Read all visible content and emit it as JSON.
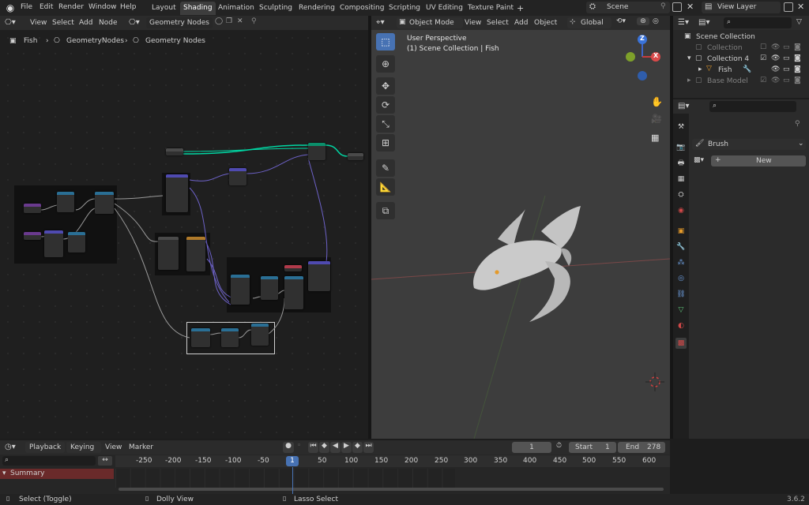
{
  "topbar": {
    "menus": [
      "File",
      "Edit",
      "Render",
      "Window",
      "Help"
    ],
    "workspaces": [
      "Layout",
      "Shading",
      "Animation",
      "Sculpting",
      "Rendering",
      "Compositing",
      "Scripting",
      "UV Editing",
      "Texture Paint"
    ],
    "active_workspace": "Shading",
    "add_workspace": "+",
    "scene": "Scene",
    "view_layer": "View Layer"
  },
  "node_editor": {
    "menus": [
      "View",
      "Select",
      "Add",
      "Node"
    ],
    "node_tree_name": "Geometry Nodes",
    "breadcrumb": [
      "Fish",
      "GeometryNodes",
      "Geometry Nodes"
    ]
  },
  "viewport": {
    "mode": "Object Mode",
    "menus": [
      "View",
      "Select",
      "Add",
      "Object"
    ],
    "orientation": "Global",
    "overlay_title": "User Perspective",
    "overlay_subtitle": "(1) Scene Collection | Fish",
    "gizmo_axes": [
      "Z",
      "X",
      "Y"
    ]
  },
  "outliner": {
    "root": "Scene Collection",
    "items": [
      {
        "label": "Collection",
        "dim": true
      },
      {
        "label": "Collection 4",
        "dim": false
      },
      {
        "label": "Fish",
        "dim": false
      },
      {
        "label": "Base Model",
        "dim": true
      }
    ]
  },
  "properties": {
    "brush_label": "Brush",
    "new_button": "New"
  },
  "timeline": {
    "menus": [
      "Playback",
      "Keying",
      "View",
      "Marker"
    ],
    "current_frame": "1",
    "start_label": "Start",
    "start_value": "1",
    "end_label": "End",
    "end_value": "278",
    "ruler": [
      "-250",
      "-200",
      "-150",
      "-100",
      "-50",
      "1",
      "50",
      "100",
      "150",
      "200",
      "250",
      "300",
      "350",
      "400",
      "450",
      "500",
      "550",
      "600"
    ],
    "summary": "Summary"
  },
  "statusbar": {
    "select": "Select (Toggle)",
    "dolly": "Dolly View",
    "lasso": "Lasso Select",
    "version": "3.6.2"
  },
  "colors": {
    "accent": "#4772b3",
    "active_tab": "#3d3d3d",
    "link_green": "#00d6a3",
    "link_purple": "#6d62c8"
  }
}
